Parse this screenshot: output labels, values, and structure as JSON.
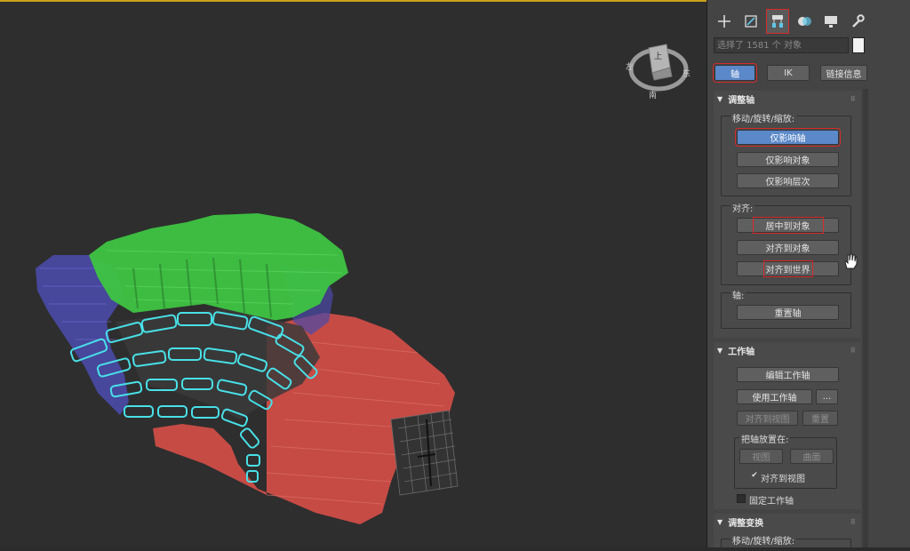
{
  "panel": {
    "selection_text": "选择了 1581 个 对象",
    "top_buttons": {
      "pivot": "轴",
      "ik": "IK",
      "link_info": "链接信息"
    },
    "adjust_pivot": {
      "title": "调整轴",
      "move_group_label": "移动/旋转/缩放:",
      "affect_pivot_only": "仅影响轴",
      "affect_object_only": "仅影响对象",
      "affect_hierarchy_only": "仅影响层次",
      "align_group_label": "对齐:",
      "center_to_object": "居中到对象",
      "align_to_object": "对齐到对象",
      "align_to_world": "对齐到世界",
      "pivot_group_label": "轴:",
      "reset_pivot": "重置轴"
    },
    "working_pivot": {
      "title": "工作轴",
      "edit_working_pivot": "编辑工作轴",
      "use_working_pivot": "使用工作轴",
      "ellipsis": "...",
      "align_to_view": "对齐到视图",
      "reset": "重置",
      "place_pivot_group_label": "把轴放置在:",
      "view": "视图",
      "surface": "曲面",
      "align_to_view_check": "对齐到视图",
      "check_mark": "✔",
      "lock_working_pivot": "固定工作轴"
    },
    "adjust_transform": {
      "title": "调整变换",
      "move_group_label": "移动/旋转/缩放:"
    }
  },
  "viewcube": {
    "top": "上",
    "left": "左",
    "right": "东",
    "bottom": "南"
  },
  "colors": {
    "accent_blue": "#5b88c8",
    "highlight_red": "#d62a2a",
    "viewport_border": "#c8a21a"
  },
  "icons": [
    "create-plus-icon",
    "modify-icon",
    "hierarchy-icon",
    "motion-icon",
    "display-icon",
    "utilities-wrench-icon",
    "hand-cursor-icon"
  ]
}
